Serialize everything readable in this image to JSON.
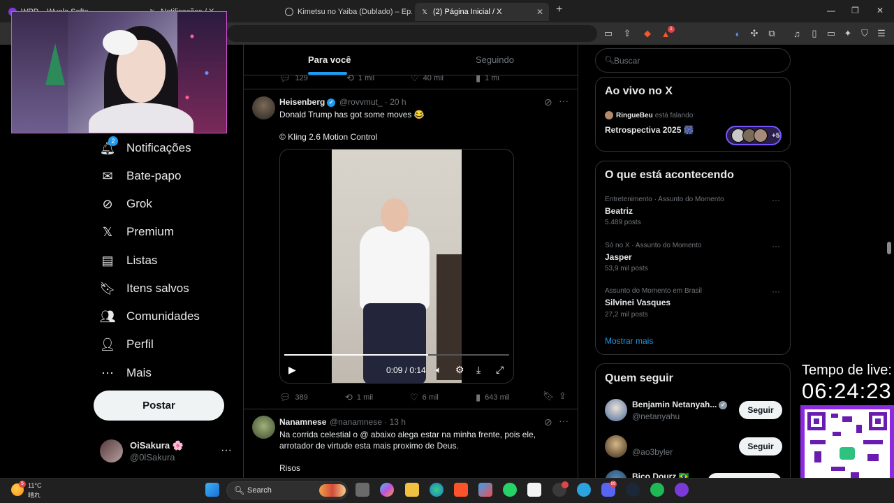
{
  "browser": {
    "tabs": [
      {
        "label": "WPP – Wuola Softe..."
      },
      {
        "label": "Notificações / X"
      },
      {
        "label": "Kimetsu no Yaiba (Dublado) – Ep..."
      },
      {
        "label": "(2) Página Inicial / X"
      }
    ],
    "new_tab": "+",
    "extension_badge": "1"
  },
  "nav": {
    "notifications": {
      "label": "Notificações",
      "badge": "2"
    },
    "items": [
      {
        "label": "Bate-papo"
      },
      {
        "label": "Grok"
      },
      {
        "label": "Premium"
      },
      {
        "label": "Listas"
      },
      {
        "label": "Itens salvos"
      },
      {
        "label": "Comunidades"
      },
      {
        "label": "Perfil"
      },
      {
        "label": "Mais"
      }
    ],
    "post_button": "Postar",
    "account": {
      "name": "OiSakura 🌸",
      "handle": "@0lSakura",
      "more": "···"
    }
  },
  "feed": {
    "tabs": {
      "for_you": "Para você",
      "following": "Seguindo"
    },
    "prev_actions": {
      "replies": "129",
      "reposts": "1 mil",
      "likes": "40 mil",
      "views": "1 mi"
    },
    "tweet1": {
      "name": "Heisenberg",
      "handle": "@rovvmut_",
      "time": "· 20 h",
      "text1": "Donald Trump has got some moves 😂",
      "text2": "© Kling 2.6 Motion Control",
      "video": {
        "time": "0:09 / 0:14",
        "progress": 0.64
      },
      "actions": {
        "replies": "389",
        "reposts": "1 mil",
        "likes": "6 mil",
        "views": "643 mil"
      }
    },
    "tweet2": {
      "name": "Nanamnese",
      "handle": "@nanamnese",
      "time": "· 13 h",
      "text1": "Na corrida celestial o @ abaixo alega estar na minha frente, pois ele,",
      "text2": "arrotador de virtude esta mais proximo de Deus.",
      "text3": "Risos"
    }
  },
  "right": {
    "search_placeholder": "Buscar",
    "live": {
      "title": "Ao vivo no X",
      "host": "RingueBeu",
      "host_suffix": "está falando",
      "space": "Retrospectiva 2025 🎆",
      "plus": "+5"
    },
    "trends": {
      "title": "O que está acontecendo",
      "items": [
        {
          "context": "Entretenimento · Assunto do Momento",
          "name": "Beatriz",
          "posts": "5.489 posts"
        },
        {
          "context": "Só no X · Assunto do Momento",
          "name": "Jasper",
          "posts": "53,9 mil posts"
        },
        {
          "context": "Assunto do Momento em Brasil",
          "name": "Silvinei Vasques",
          "posts": "27,2 mil posts"
        }
      ],
      "show_more": "Mostrar mais"
    },
    "follow": {
      "title": "Quem seguir",
      "items": [
        {
          "name": "Benjamin Netanyah...",
          "handle": "@netanyahu",
          "button": "Seguir"
        },
        {
          "name": "",
          "handle": "@ao3byler",
          "button": "Seguir"
        },
        {
          "name": "Bico Dourz 🇧🇷",
          "handle": "",
          "button": ""
        }
      ]
    }
  },
  "overlay": {
    "live_label": "Tempo de live:",
    "live_time": "06:24:23"
  },
  "taskbar": {
    "temp": "11°C",
    "condition": "晴れ",
    "weather_badge": "5",
    "search_label": "Search",
    "discord_badge": "99"
  }
}
